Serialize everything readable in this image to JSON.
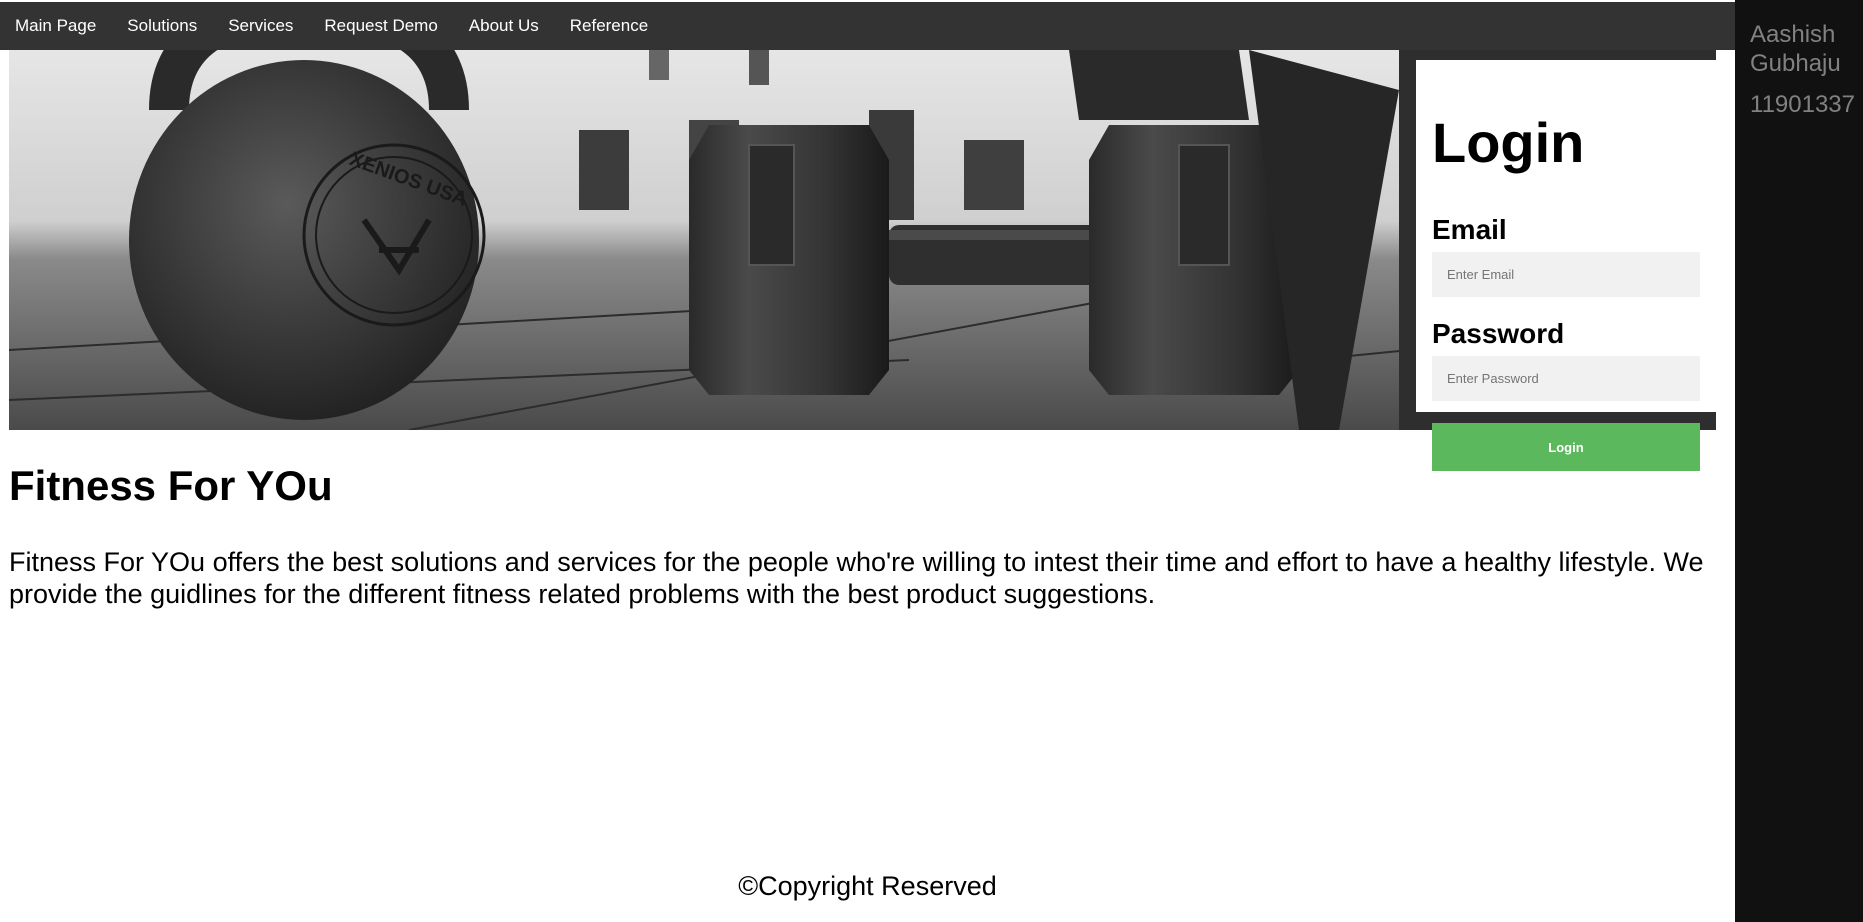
{
  "nav": {
    "items": [
      {
        "label": "Main Page"
      },
      {
        "label": "Solutions"
      },
      {
        "label": "Services"
      },
      {
        "label": "Request Demo"
      },
      {
        "label": "About Us"
      },
      {
        "label": "Reference"
      }
    ]
  },
  "sidebar": {
    "name": "Aashish Gubhaju",
    "id": "11901337"
  },
  "hero": {
    "image": "gym-kettlebell-dumbbells-photo",
    "kettlebell_text": "XENIOS USA"
  },
  "login": {
    "title": "Login",
    "email_label": "Email",
    "email_placeholder": "Enter Email",
    "password_label": "Password",
    "password_placeholder": "Enter Password",
    "button_label": "Login",
    "button_color": "#5cb85c"
  },
  "main": {
    "heading": "Fitness For YOu",
    "paragraph": "Fitness For YOu offers the best solutions and services for the people who're willing to intest their time and effort to have a healthy lifestyle. We provide the guidlines for the different fitness related problems with the best product suggestions."
  },
  "footer": {
    "text": "©Copyright Reserved"
  },
  "colors": {
    "nav_bg": "#333333",
    "sidebar_bg": "#111111",
    "sidebar_text": "#818181"
  }
}
